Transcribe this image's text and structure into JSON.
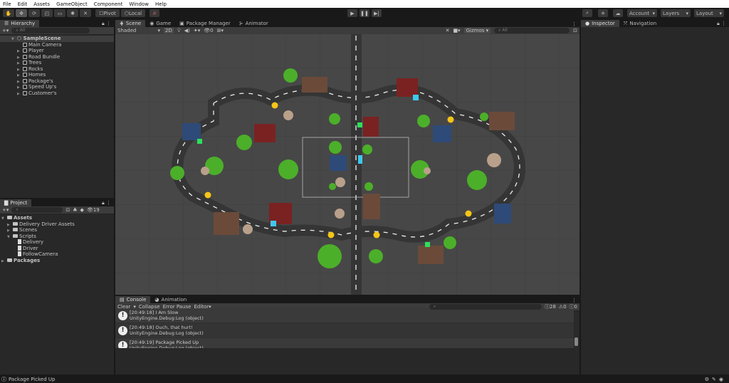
{
  "menu": [
    "File",
    "Edit",
    "Assets",
    "GameObject",
    "Component",
    "Window",
    "Help"
  ],
  "toolbar": {
    "pivot": "Pivot",
    "local": "Local",
    "account": "Account",
    "layers": "Layers",
    "layout": "Layout"
  },
  "hierarchy": {
    "title": "Hierarchy",
    "search_placeholder": "All",
    "scene": "SampleScene",
    "items": [
      "Main Camera",
      "Player",
      "Road Bundle",
      "Trees",
      "Rocks",
      "Homes",
      "Package's",
      "Speed Up's",
      "Customer's"
    ]
  },
  "project": {
    "title": "Project",
    "hidden_count": "19",
    "assets": "Assets",
    "folders": [
      "Delivery Driver Assets",
      "Scenes",
      "Scripts"
    ],
    "scripts": [
      "Delivery",
      "Driver",
      "FollowCamera"
    ],
    "packages": "Packages"
  },
  "scene": {
    "tabs": [
      "Scene",
      "Game",
      "Package Manager",
      "Animator"
    ],
    "shading": "Shaded",
    "mode_2d": "2D",
    "hidden_count": "0",
    "gizmos": "Gizmos",
    "search_placeholder": "All"
  },
  "console": {
    "tabs": [
      "Console",
      "Animation"
    ],
    "clear": "Clear",
    "collapse": "Collapse",
    "error_pause": "Error Pause",
    "editor": "Editor",
    "log_count": "28",
    "warn_count": "0",
    "error_count": "0",
    "entries": [
      {
        "msg": "[20:49:18] I Am Slow",
        "src": "UnityEngine.Debug:Log (object)"
      },
      {
        "msg": "[20:49:18] Ouch, that hurt!",
        "src": "UnityEngine.Debug:Log (object)"
      },
      {
        "msg": "[20:49:19] Package Picked Up",
        "src": "UnityEngine.Debug:Log (object)"
      }
    ]
  },
  "inspector": {
    "tabs": [
      "Inspector",
      "Navigation"
    ]
  },
  "status": {
    "message": "Package Picked Up"
  },
  "colors": {
    "scene_bg": "#474747",
    "road": "#3a3a3a",
    "package": "#3ec8f0",
    "speedup": "#f5c518",
    "customer": "#2ee05a"
  }
}
